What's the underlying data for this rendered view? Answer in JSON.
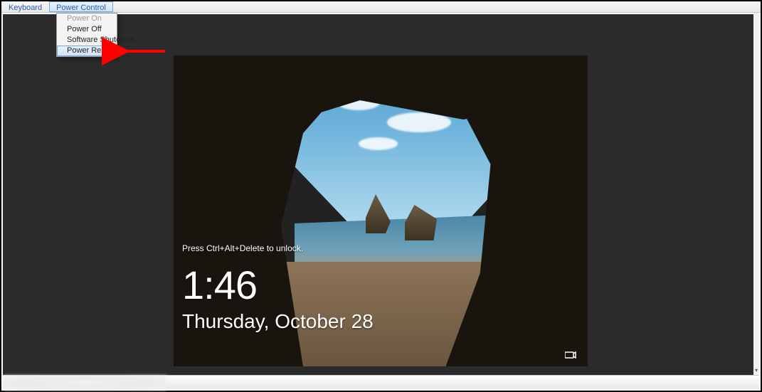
{
  "menubar": {
    "keyboard_label": "Keyboard",
    "power_control_label": "Power Control"
  },
  "power_menu": {
    "items": [
      {
        "label": "Power On",
        "disabled": true,
        "highlight": false
      },
      {
        "label": "Power Off",
        "disabled": false,
        "highlight": false
      },
      {
        "label": "Software Shutdown",
        "disabled": false,
        "highlight": false
      },
      {
        "label": "Power Reset",
        "disabled": false,
        "highlight": true
      }
    ]
  },
  "lockscreen": {
    "unlock_hint": "Press Ctrl+Alt+Delete to unlock.",
    "time": "1:46",
    "date": "Thursday, October 28"
  },
  "annotation": {
    "arrow_points_to": "Power Reset"
  },
  "colors": {
    "viewer_bg": "#2b2b2b",
    "menu_highlight": "#cde2f9",
    "arrow": "#ff0000"
  }
}
